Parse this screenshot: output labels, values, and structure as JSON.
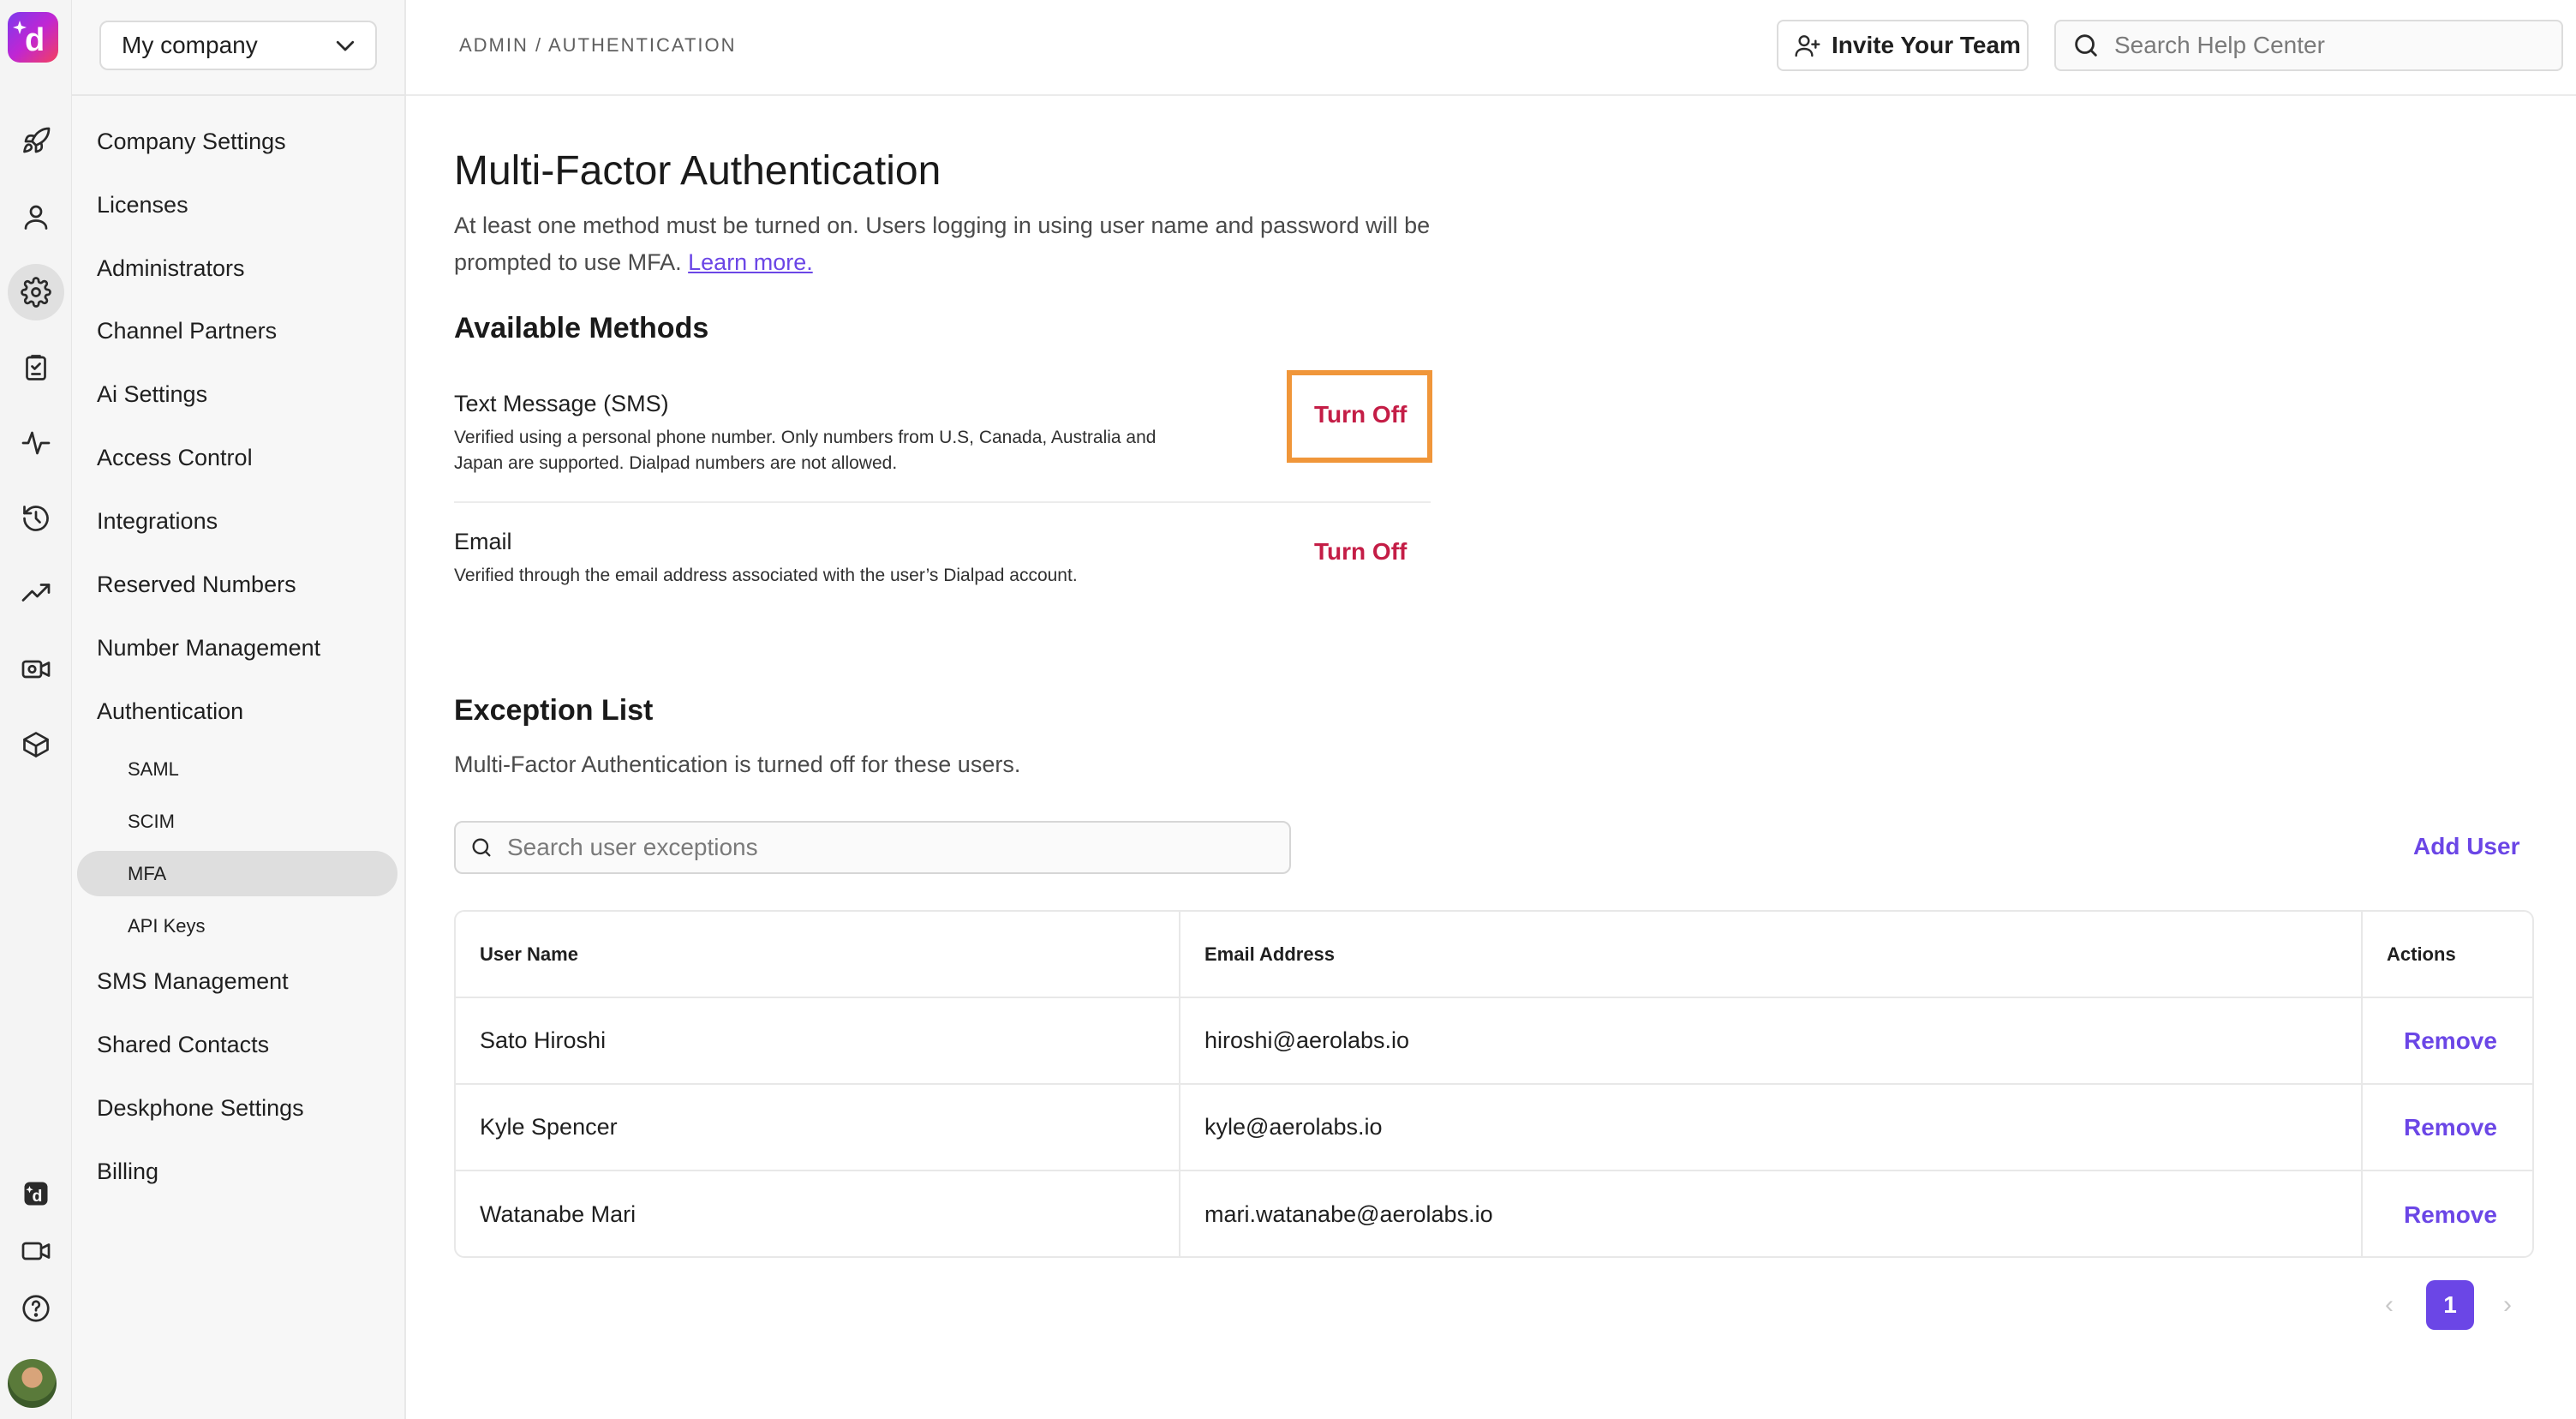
{
  "colors": {
    "accent": "#6b46e6",
    "danger": "#c41d46",
    "highlight": "#f0963a"
  },
  "rail": {
    "icons": [
      "rocket-icon",
      "user-icon",
      "gear-icon",
      "clipboard-icon",
      "activity-icon",
      "history-icon",
      "trending-icon",
      "video-settings-icon",
      "box-icon",
      "dialpad-ai-icon",
      "video-icon",
      "help-icon"
    ]
  },
  "sidebar": {
    "company": "My company",
    "items": [
      {
        "label": "Company Settings"
      },
      {
        "label": "Licenses"
      },
      {
        "label": "Administrators"
      },
      {
        "label": "Channel Partners"
      },
      {
        "label": "Ai Settings"
      },
      {
        "label": "Access Control"
      },
      {
        "label": "Integrations"
      },
      {
        "label": "Reserved Numbers"
      },
      {
        "label": "Number Management"
      },
      {
        "label": "Authentication"
      },
      {
        "label": "SMS Management"
      },
      {
        "label": "Shared Contacts"
      },
      {
        "label": "Deskphone Settings"
      },
      {
        "label": "Billing"
      }
    ],
    "auth_sub": [
      {
        "label": "SAML"
      },
      {
        "label": "SCIM"
      },
      {
        "label": "MFA"
      },
      {
        "label": "API Keys"
      }
    ]
  },
  "header": {
    "breadcrumb": "ADMIN / AUTHENTICATION",
    "invite_label": "Invite Your Team",
    "help_placeholder": "Search Help Center"
  },
  "page": {
    "title": "Multi-Factor Authentication",
    "description": "At least one method must be turned on. Users logging in using user name and password will be prompted to use MFA.",
    "learn_more": "Learn more.",
    "methods_heading": "Available Methods",
    "methods": [
      {
        "title": "Text Message (SMS)",
        "description": "Verified using a personal phone number. Only numbers from U.S, Canada, Australia and Japan are supported. Dialpad numbers are not allowed.",
        "action": "Turn Off"
      },
      {
        "title": "Email",
        "description": "Verified through the email address associated with the user’s Dialpad account.",
        "action": "Turn Off"
      }
    ],
    "exception_heading": "Exception List",
    "exception_description": "Multi-Factor Authentication is turned off for these users.",
    "exception_search_placeholder": "Search user exceptions",
    "add_user": "Add User",
    "table": {
      "columns": [
        "User Name",
        "Email Address",
        "Actions"
      ],
      "rows": [
        {
          "name": "Sato Hiroshi",
          "email": "hiroshi@aerolabs.io",
          "action": "Remove"
        },
        {
          "name": "Kyle Spencer",
          "email": "kyle@aerolabs.io",
          "action": "Remove"
        },
        {
          "name": "Watanabe Mari",
          "email": "mari.watanabe@aerolabs.io",
          "action": "Remove"
        }
      ]
    },
    "pagination": {
      "current": "1",
      "prev": "‹",
      "next": "›"
    }
  }
}
